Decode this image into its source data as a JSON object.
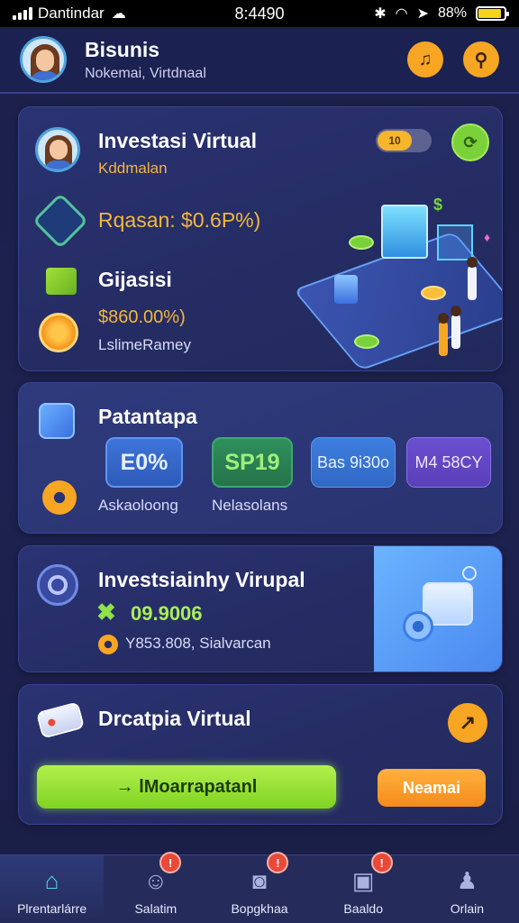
{
  "status_bar": {
    "carrier": "Dantindar",
    "time": "8:4490",
    "battery": "88%",
    "battery_level": 0.88
  },
  "header": {
    "title": "Bisunis",
    "subtitle": "Nokemai, Virtdnaal"
  },
  "card_investasi": {
    "title": "Investasi Virtual",
    "subtitle": "Kddmalan",
    "toggle_label": "10",
    "return_label": "Rqasan: $0.6P%)",
    "section_title": "Gijasisi",
    "amount": "$860.00%)",
    "footer": "LslimeRamey"
  },
  "card_patantapa": {
    "title": "Patantapa",
    "chips": [
      "E0%",
      "SP19",
      "Bas 9i30o",
      "M4 58CY"
    ],
    "label_left": "Askaoloong",
    "label_right": "Nelasolans"
  },
  "card_investsiainhy": {
    "title": "Investsiainhy Virupal",
    "value": "09.9006",
    "detail": "Y853.808, Sialvarcan"
  },
  "card_drcatapia": {
    "title": "Drcatpia Virtual",
    "primary_button": "→ lMoarrapatanl",
    "secondary_button": "Neamai"
  },
  "bottom_nav": {
    "items": [
      {
        "label": "Plrentarlárre",
        "icon": "home-icon",
        "badge": ""
      },
      {
        "label": "Salatim",
        "icon": "chat-icon",
        "badge": "!"
      },
      {
        "label": "Bopgkhaa",
        "icon": "camera-icon",
        "badge": "!"
      },
      {
        "label": "Baaldo",
        "icon": "wallet-icon",
        "badge": "!"
      },
      {
        "label": "Orlain",
        "icon": "profile-icon",
        "badge": ""
      }
    ]
  },
  "colors": {
    "background": "#1a1f45",
    "card": "#252c63",
    "accent_orange": "#f6a623",
    "accent_green": "#7fd323",
    "accent_blue": "#3f74d9"
  }
}
